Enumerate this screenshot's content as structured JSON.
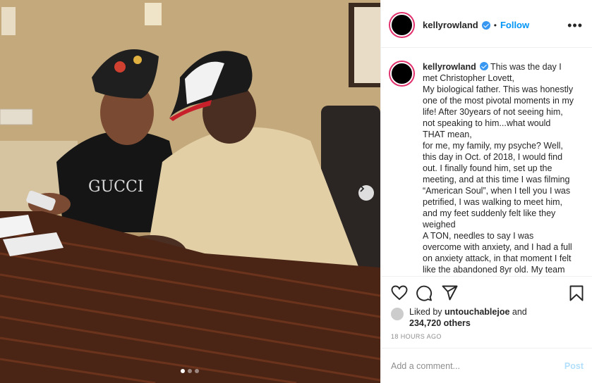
{
  "post": {
    "username": "kellyrowland",
    "separator": "•",
    "follow_label": "Follow",
    "more_label": "•••",
    "caption": "This was the day I met Christopher Lovett,\nMy biological father. This was honestly one of the most pivotal moments in my life! After 30years of not seeing him, not speaking to him...what would THAT mean,\nfor me, my family, my psyche? Well, this day in Oct. of 2018, I would find out. I finally found him, set up the meeting, and at this time I was filming “American Soul”, when I tell you I was petrified, I was walking to meet him, and my feet suddenly felt like they weighed\nA TON, needles to say I was overcome with anxiety, and I had a full on anxiety attack, in that moment I felt like the abandoned 8yr old. My team",
    "liked_by_prefix": "Liked by",
    "liked_by_user": "untouchablejoe",
    "liked_by_and": "and",
    "likes_count": "234,720 others",
    "timestamp": "18 HOURS AGO",
    "comment_placeholder": "Add a comment...",
    "post_label": "Post"
  },
  "carousel": {
    "slides": 3,
    "active": 1
  },
  "icons": {
    "verified": "verified-badge-icon",
    "heart": "heart-icon",
    "comment": "comment-icon",
    "share": "share-icon",
    "save": "bookmark-icon",
    "next": "chevron-right-icon"
  },
  "colors": {
    "accent": "#0095f6",
    "story_ring": "#e1306c",
    "text": "#262626",
    "muted": "#8e8e8e"
  }
}
